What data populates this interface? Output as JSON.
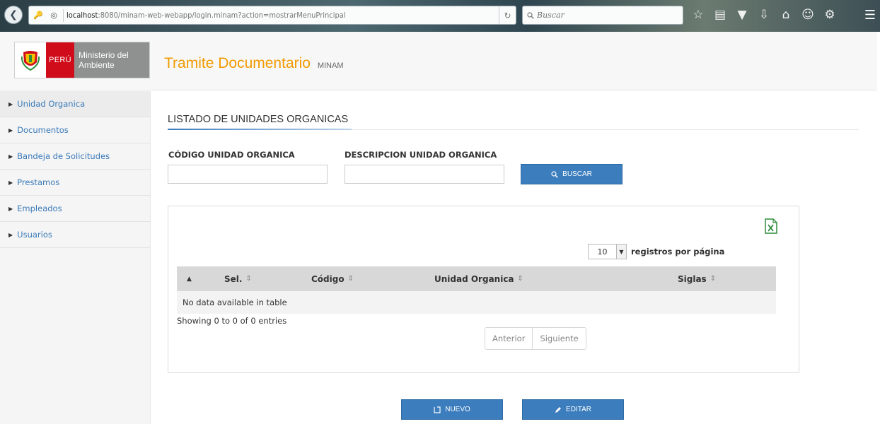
{
  "browser": {
    "url_host": "localhost",
    "url_path": ":8080/minam-web-webapp/login.minam?action=mostrarMenuPrincipal",
    "search_placeholder": "Buscar"
  },
  "header": {
    "logo_country": "PERÚ",
    "logo_ministry_line1": "Ministerio del",
    "logo_ministry_line2": "Ambiente",
    "app_title": "Tramite Documentario",
    "app_subtitle": "MINAM"
  },
  "sidebar": {
    "items": [
      {
        "label": "Unidad Organica"
      },
      {
        "label": "Documentos"
      },
      {
        "label": "Bandeja de Solicitudes"
      },
      {
        "label": "Prestamos"
      },
      {
        "label": "Empleados"
      },
      {
        "label": "Usuarios"
      }
    ]
  },
  "main": {
    "section_title": "LISTADO DE UNIDADES ORGANICAS",
    "code_label": "CÓDIGO UNIDAD ORGANICA",
    "code_value": "",
    "desc_label": "DESCRIPCION UNIDAD ORGANICA",
    "desc_value": "",
    "search_button": "BUSCAR",
    "new_button": "NUEVO",
    "edit_button": "EDITAR"
  },
  "table": {
    "page_size": "10",
    "page_size_label": "registros por página",
    "columns": [
      "Sel.",
      "Código",
      "Unidad Organica",
      "Siglas"
    ],
    "empty_message": "No data available in table",
    "info": "Showing 0 to 0 of 0 entries",
    "prev_label": "Anterior",
    "next_label": "Siguiente"
  },
  "colors": {
    "accent_orange": "#f29a00",
    "button_blue": "#3b7dbd",
    "link_blue": "#3a7ab8",
    "peru_red": "#d00c1a"
  }
}
